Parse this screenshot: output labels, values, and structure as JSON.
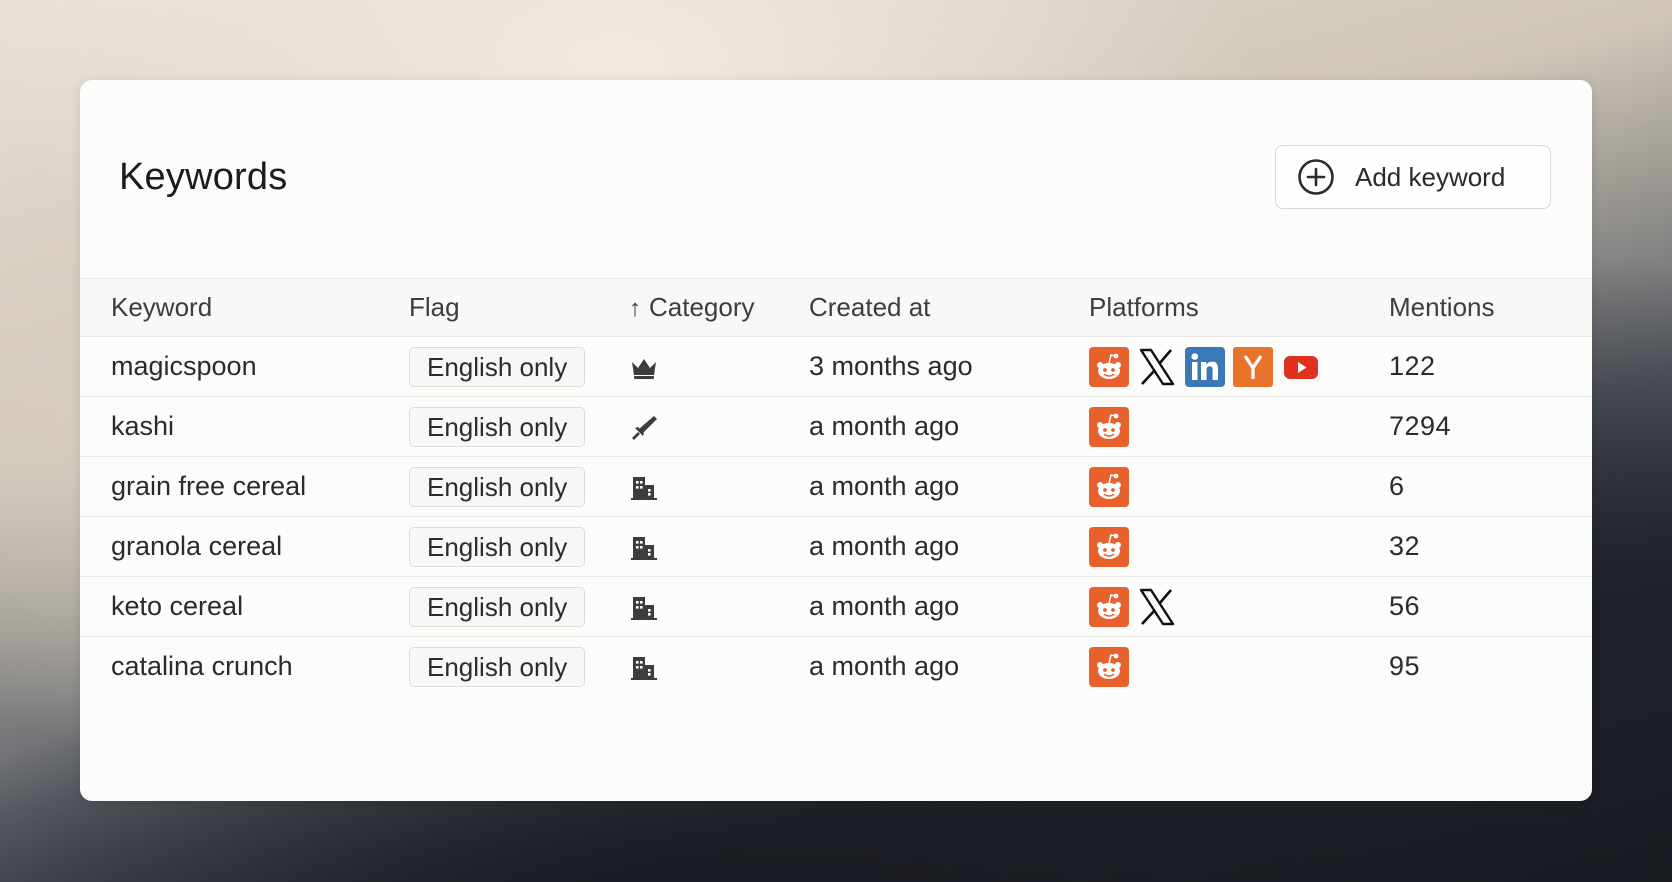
{
  "header": {
    "title": "Keywords",
    "add_button_label": "Add keyword"
  },
  "table": {
    "columns": {
      "keyword": "Keyword",
      "flag": "Flag",
      "category": "Category",
      "category_sort": "↑",
      "created_at": "Created at",
      "platforms": "Platforms",
      "mentions": "Mentions"
    },
    "rows": [
      {
        "keyword": "magicspoon",
        "flag": "English only",
        "category_icon": "crown-icon",
        "created_at": "3 months ago",
        "platforms": [
          "reddit",
          "x",
          "linkedin",
          "hackernews",
          "youtube"
        ],
        "mentions": "122"
      },
      {
        "keyword": "kashi",
        "flag": "English only",
        "category_icon": "sword-icon",
        "created_at": "a month ago",
        "platforms": [
          "reddit"
        ],
        "mentions": "7294"
      },
      {
        "keyword": "grain free cereal",
        "flag": "English only",
        "category_icon": "building-icon",
        "created_at": "a month ago",
        "platforms": [
          "reddit"
        ],
        "mentions": "6"
      },
      {
        "keyword": "granola cereal",
        "flag": "English only",
        "category_icon": "building-icon",
        "created_at": "a month ago",
        "platforms": [
          "reddit"
        ],
        "mentions": "32"
      },
      {
        "keyword": "keto cereal",
        "flag": "English only",
        "category_icon": "building-icon",
        "created_at": "a month ago",
        "platforms": [
          "reddit",
          "x"
        ],
        "mentions": "56"
      },
      {
        "keyword": "catalina crunch",
        "flag": "English only",
        "category_icon": "building-icon",
        "created_at": "a month ago",
        "platforms": [
          "reddit"
        ],
        "mentions": "95"
      }
    ]
  },
  "colors": {
    "reddit": "#e8612c",
    "linkedin": "#3a78b8",
    "hackernews": "#e8742c",
    "youtube": "#e0301e",
    "x": "#111111",
    "icon_dark": "#3d3d3d"
  }
}
